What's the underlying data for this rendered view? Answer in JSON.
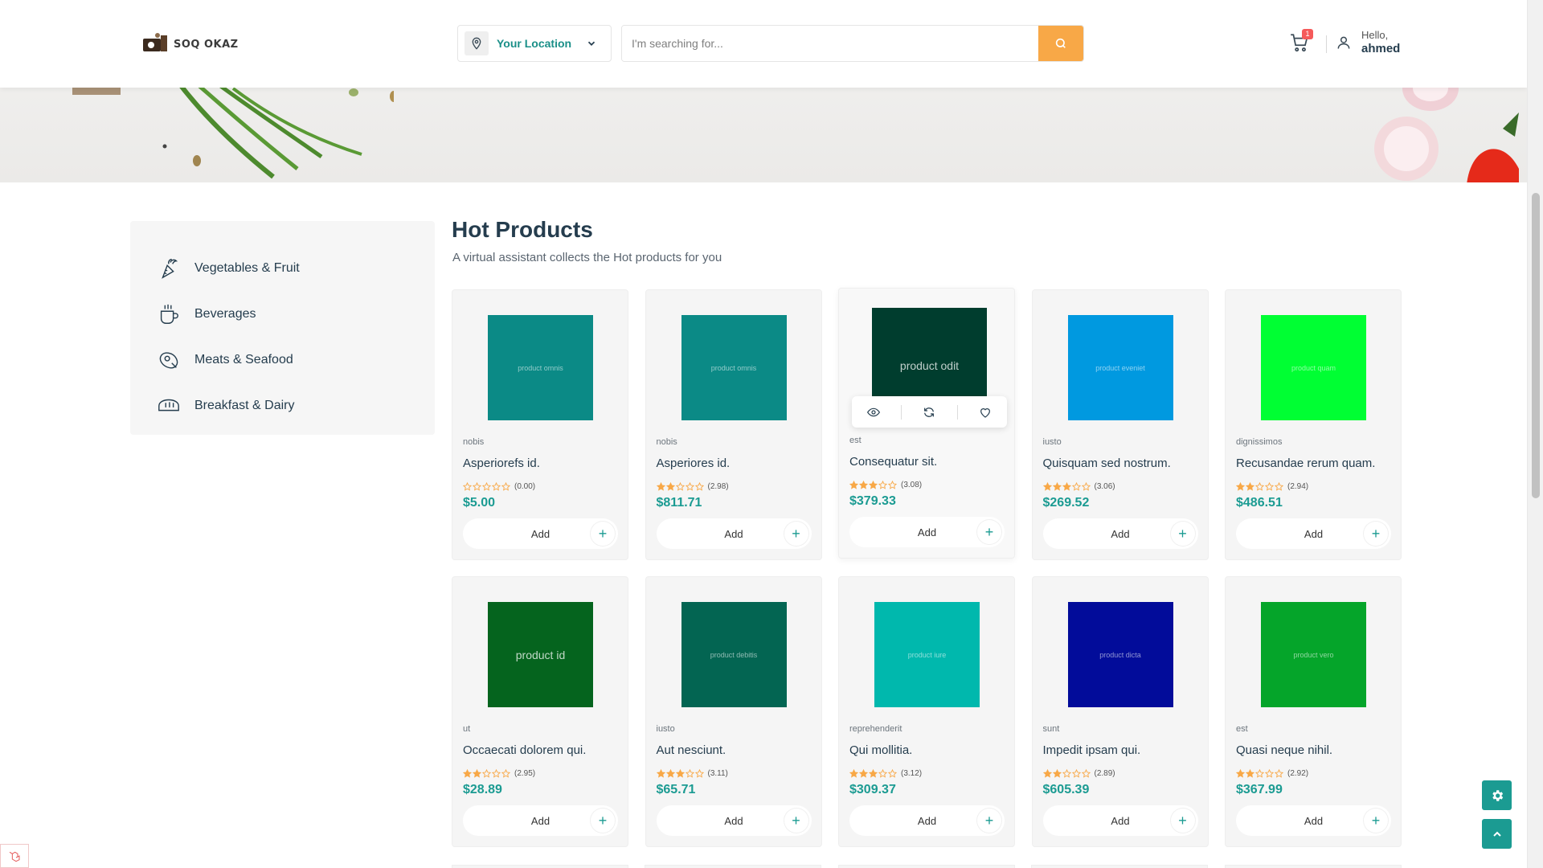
{
  "header": {
    "logo_text": "SOQ OKAZ",
    "location_label": "Your Location",
    "search_placeholder": "I'm searching for...",
    "cart_count": "1",
    "greeting": "Hello,",
    "username": "ahmed"
  },
  "sidebar": {
    "items": [
      {
        "label": "Vegetables & Fruit",
        "icon": "vegetables-icon"
      },
      {
        "label": "Beverages",
        "icon": "beverage-cup-icon"
      },
      {
        "label": "Meats & Seafood",
        "icon": "meat-icon"
      },
      {
        "label": "Breakfast & Dairy",
        "icon": "bread-icon"
      }
    ]
  },
  "main": {
    "title": "Hot Products",
    "subtitle": "A virtual assistant collects the Hot products for you"
  },
  "colors": {
    "accent": "#1b9b92",
    "search_button": "#f8a847",
    "badge": "#f55a5a"
  },
  "add_label": "Add",
  "products": [
    {
      "img_text": "product omnis",
      "img_color": "#0b8a86",
      "category": "nobis",
      "name": "Asperiorefs id.",
      "rating": "(0.00)",
      "stars": 0,
      "price": "$5.00"
    },
    {
      "img_text": "product omnis",
      "img_color": "#0b8a86",
      "category": "nobis",
      "name": "Asperiores id.",
      "rating": "(2.98)",
      "stars": 2,
      "price": "$811.71"
    },
    {
      "img_text": "product odit",
      "img_color": "#003d2e",
      "category": "est",
      "name": "Consequatur sit.",
      "rating": "(3.08)",
      "stars": 3,
      "price": "$379.33",
      "active": true
    },
    {
      "img_text": "product eveniet",
      "img_color": "#0099e0",
      "category": "iusto",
      "name": "Quisquam sed nostrum.",
      "rating": "(3.06)",
      "stars": 3,
      "price": "$269.52"
    },
    {
      "img_text": "product quam",
      "img_color": "#00ff33",
      "category": "dignissimos",
      "name": "Recusandae rerum quam.",
      "rating": "(2.94)",
      "stars": 2,
      "price": "$486.51"
    },
    {
      "img_text": "product id",
      "img_color": "#05641e",
      "category": "ut",
      "name": "Occaecati dolorem qui.",
      "rating": "(2.95)",
      "stars": 2,
      "price": "$28.89",
      "big": true
    },
    {
      "img_text": "product debitis",
      "img_color": "#036552",
      "category": "iusto",
      "name": "Aut nesciunt.",
      "rating": "(3.11)",
      "stars": 3,
      "price": "$65.71"
    },
    {
      "img_text": "product iure",
      "img_color": "#00b8ad",
      "category": "reprehenderit",
      "name": "Qui mollitia.",
      "rating": "(3.12)",
      "stars": 3,
      "price": "$309.37"
    },
    {
      "img_text": "product dicta",
      "img_color": "#020c9a",
      "category": "sunt",
      "name": "Impedit ipsam qui.",
      "rating": "(2.89)",
      "stars": 2,
      "price": "$605.39"
    },
    {
      "img_text": "product vero",
      "img_color": "#05a52a",
      "category": "est",
      "name": "Quasi neque nihil.",
      "rating": "(2.92)",
      "stars": 2,
      "price": "$367.99"
    }
  ]
}
